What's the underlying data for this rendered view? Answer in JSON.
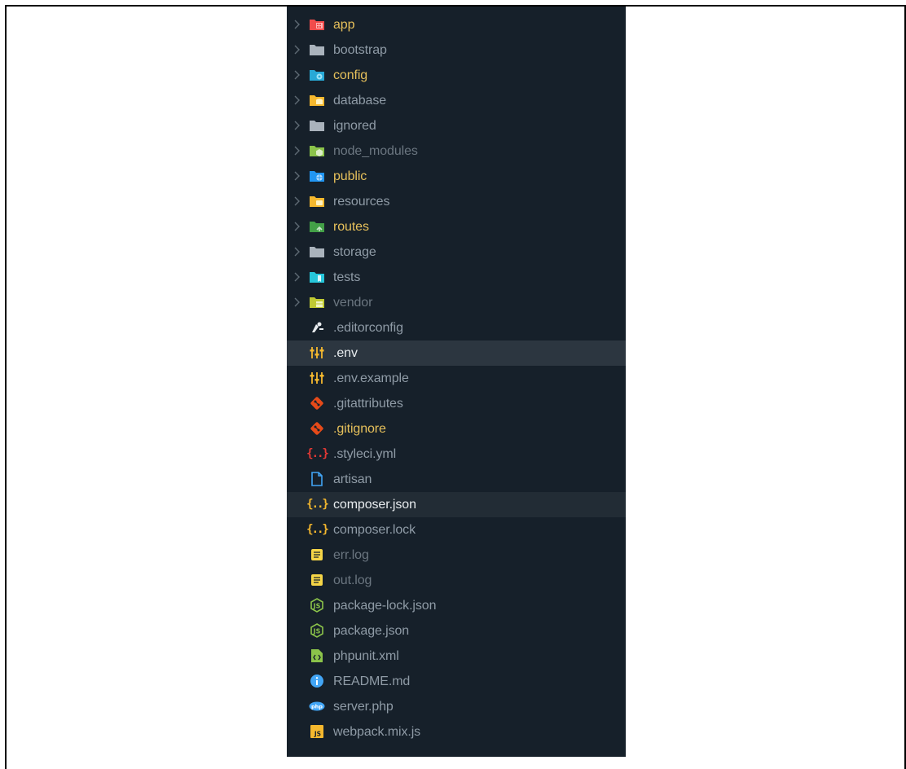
{
  "explorer": {
    "items": [
      {
        "label": "app",
        "type": "folder",
        "icon": "folder-app-icon",
        "color": "#f14c4c"
      },
      {
        "label": "bootstrap",
        "type": "folder",
        "icon": "folder-icon",
        "color": "#aab3bc"
      },
      {
        "label": "config",
        "type": "folder",
        "icon": "folder-config-icon",
        "color": "#28a9d6"
      },
      {
        "label": "database",
        "type": "folder",
        "icon": "folder-database-icon",
        "color": "#f5b82e"
      },
      {
        "label": "ignored",
        "type": "folder",
        "icon": "folder-icon",
        "color": "#aab3bc"
      },
      {
        "label": "node_modules",
        "type": "folder",
        "icon": "folder-node-icon",
        "color": "#8bc34a"
      },
      {
        "label": "public",
        "type": "folder",
        "icon": "folder-public-icon",
        "color": "#2196f3"
      },
      {
        "label": "resources",
        "type": "folder",
        "icon": "folder-resources-icon",
        "color": "#f5b82e"
      },
      {
        "label": "routes",
        "type": "folder",
        "icon": "folder-routes-icon",
        "color": "#43a047"
      },
      {
        "label": "storage",
        "type": "folder",
        "icon": "folder-icon",
        "color": "#aab3bc"
      },
      {
        "label": "tests",
        "type": "folder",
        "icon": "folder-tests-icon",
        "color": "#26c6da"
      },
      {
        "label": "vendor",
        "type": "folder",
        "icon": "folder-vendor-icon",
        "color": "#c0ca33"
      },
      {
        "label": ".editorconfig",
        "type": "file",
        "icon": "editorconfig-icon",
        "color": "#e8ecef"
      },
      {
        "label": ".env",
        "type": "file",
        "icon": "env-settings-icon",
        "color": "#f5b82e"
      },
      {
        "label": ".env.example",
        "type": "file",
        "icon": "env-settings-icon",
        "color": "#f5b82e"
      },
      {
        "label": ".gitattributes",
        "type": "file",
        "icon": "git-icon",
        "color": "#e64a19"
      },
      {
        "label": ".gitignore",
        "type": "file",
        "icon": "git-icon",
        "color": "#e64a19"
      },
      {
        "label": ".styleci.yml",
        "type": "file",
        "icon": "yaml-icon",
        "color": "#e53935"
      },
      {
        "label": "artisan",
        "type": "file",
        "icon": "file-icon",
        "color": "#42a5f5"
      },
      {
        "label": "composer.json",
        "type": "file",
        "icon": "json-icon",
        "color": "#f5b82e"
      },
      {
        "label": "composer.lock",
        "type": "file",
        "icon": "json-icon",
        "color": "#f5b82e"
      },
      {
        "label": "err.log",
        "type": "file",
        "icon": "log-icon",
        "color": "#f5d547"
      },
      {
        "label": "out.log",
        "type": "file",
        "icon": "log-icon",
        "color": "#f5d547"
      },
      {
        "label": "package-lock.json",
        "type": "file",
        "icon": "nodejs-icon",
        "color": "#8bc34a"
      },
      {
        "label": "package.json",
        "type": "file",
        "icon": "nodejs-icon",
        "color": "#8bc34a"
      },
      {
        "label": "phpunit.xml",
        "type": "file",
        "icon": "xml-icon",
        "color": "#8bc34a"
      },
      {
        "label": "README.md",
        "type": "file",
        "icon": "info-icon",
        "color": "#42a5f5"
      },
      {
        "label": "server.php",
        "type": "file",
        "icon": "php-icon",
        "color": "#42a5f5"
      },
      {
        "label": "webpack.mix.js",
        "type": "file",
        "icon": "js-icon",
        "color": "#f5b82e"
      }
    ]
  }
}
